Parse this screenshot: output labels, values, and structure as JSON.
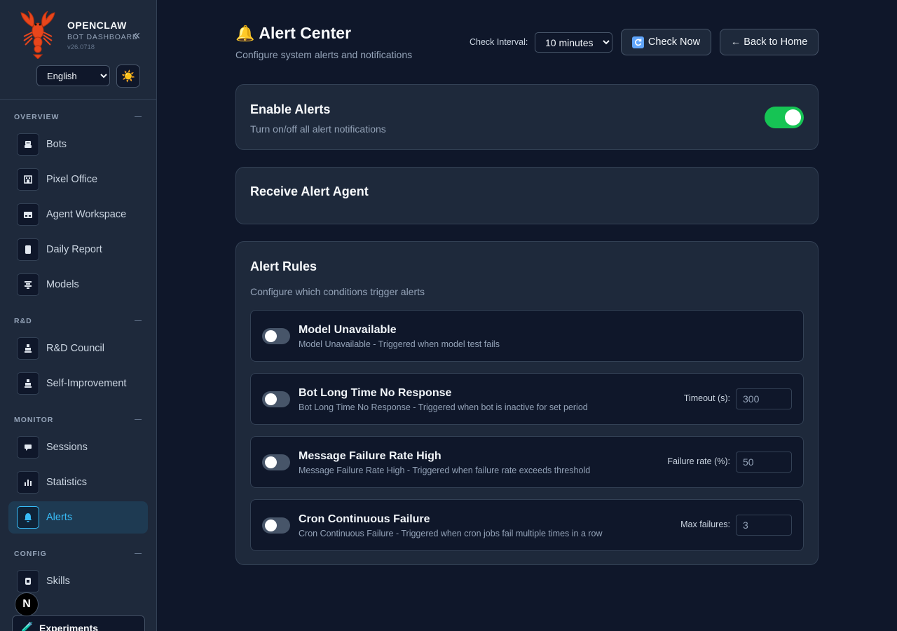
{
  "sidebar": {
    "brand_name": "OPENCLAW",
    "brand_sub": "BOT DASHBOARD",
    "version": "v26.0718",
    "collapse_icon": "«",
    "language": "English",
    "theme_icon": "☀️",
    "sections": [
      {
        "header": "OVERVIEW",
        "items": [
          {
            "label": "Bots"
          },
          {
            "label": "Pixel Office"
          },
          {
            "label": "Agent Workspace"
          },
          {
            "label": "Daily Report"
          },
          {
            "label": "Models"
          }
        ]
      },
      {
        "header": "R&D",
        "items": [
          {
            "label": "R&D Council"
          },
          {
            "label": "Self-Improvement"
          }
        ]
      },
      {
        "header": "MONITOR",
        "items": [
          {
            "label": "Sessions"
          },
          {
            "label": "Statistics"
          },
          {
            "label": "Alerts"
          }
        ]
      },
      {
        "header": "CONFIG",
        "items": [
          {
            "label": "Skills"
          }
        ]
      }
    ],
    "n_badge": "N",
    "experiments_label": "Experiments",
    "experiments_icon": "🧪"
  },
  "header": {
    "icon": "🔔",
    "title": "Alert Center",
    "subtitle": "Configure system alerts and notifications",
    "check_interval_label": "Check Interval:",
    "check_interval_value": "10 minutes",
    "check_now_label": "Check Now",
    "back_label": "← Back to Home"
  },
  "enable_alerts": {
    "title": "Enable Alerts",
    "desc": "Turn on/off all alert notifications",
    "enabled": true
  },
  "receive_agent": {
    "title": "Receive Alert Agent"
  },
  "rules": {
    "title": "Alert Rules",
    "desc": "Configure which conditions trigger alerts",
    "items": [
      {
        "title": "Model Unavailable",
        "desc": "Model Unavailable - Triggered when model test fails",
        "enabled": false
      },
      {
        "title": "Bot Long Time No Response",
        "desc": "Bot Long Time No Response - Triggered when bot is inactive for set period",
        "param_label": "Timeout (s):",
        "param_value": "300",
        "enabled": false
      },
      {
        "title": "Message Failure Rate High",
        "desc": "Message Failure Rate High - Triggered when failure rate exceeds threshold",
        "param_label": "Failure rate (%):",
        "param_value": "50",
        "enabled": false
      },
      {
        "title": "Cron Continuous Failure",
        "desc": "Cron Continuous Failure - Triggered when cron jobs fail multiple times in a row",
        "param_label": "Max failures:",
        "param_value": "3",
        "enabled": false
      }
    ]
  },
  "colors": {
    "accent": "#38bdf8",
    "toggle_on": "#16c454",
    "background": "#0f172a",
    "card": "#1e293b"
  }
}
